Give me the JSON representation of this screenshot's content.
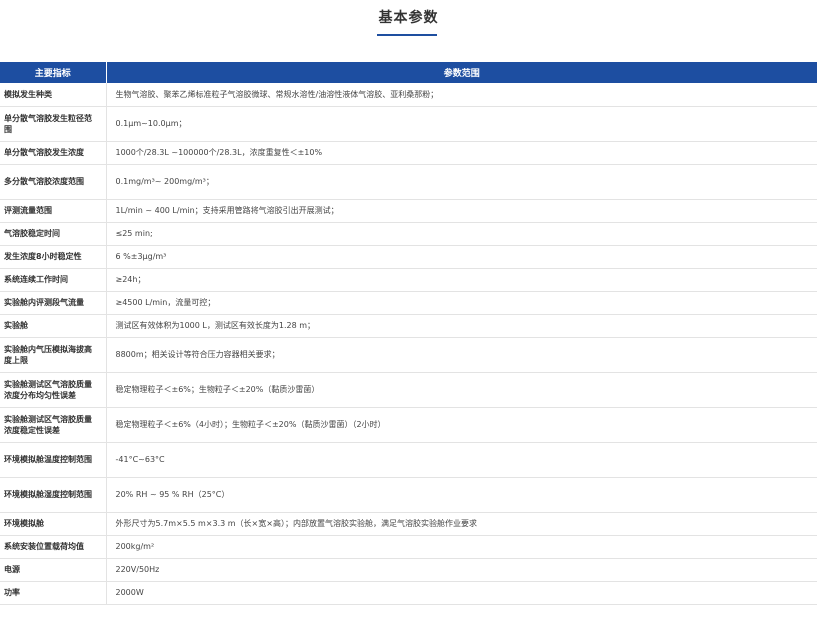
{
  "title": "基本参数",
  "table": {
    "headers": [
      "主要指标",
      "参数范围"
    ],
    "rows": [
      {
        "key": "模拟发生种类",
        "value": "生物气溶胶、聚苯乙烯标准粒子气溶胶微球、常规水溶性/油溶性液体气溶胶、亚利桑那粉；"
      },
      {
        "key": "单分散气溶胶发生粒径范围",
        "value": "0.1μm~10.0μm；"
      },
      {
        "key": "单分散气溶胶发生浓度",
        "value": "1000个/28.3L ~100000个/28.3L，浓度重复性＜±10%"
      },
      {
        "key": "多分散气溶胶浓度范围",
        "value": "0.1mg/m³~ 200mg/m³；"
      },
      {
        "key": "评测流量范围",
        "value": "1L/min ~ 400 L/min；支持采用管路将气溶胶引出开展测试；"
      },
      {
        "key": "气溶胶稳定时间",
        "value": "≤25 min;"
      },
      {
        "key": "发生浓度8小时稳定性",
        "value": "6 %±3μg/m³"
      },
      {
        "key": "系统连续工作时间",
        "value": "≥24h；"
      },
      {
        "key": "实验舱内评测段气流量",
        "value": "≥4500 L/min，流量可控；"
      },
      {
        "key": "实验舱",
        "value": "测试区有效体积为1000 L，测试区有效长度为1.28 m；"
      },
      {
        "key": "实验舱内气压模拟海拔高度上限",
        "value": "8800m；相关设计等符合压力容器相关要求；"
      },
      {
        "key": "实验舱测试区气溶胶质量浓度分布均匀性误差",
        "value": "稳定物理粒子＜±6%；生物粒子＜±20%（黏质沙雷菌）"
      },
      {
        "key": "实验舱测试区气溶胶质量浓度稳定性误差",
        "value": "稳定物理粒子＜±6%（4小时）；生物粒子＜±20%（黏质沙雷菌）（2小时）"
      },
      {
        "key": "环境模拟舱温度控制范围",
        "value": "-41°C~63°C"
      },
      {
        "key": "环境模拟舱湿度控制范围",
        "value": "20% RH ~ 95 % RH（25°C）"
      },
      {
        "key": "环境模拟舱",
        "value": "外形尺寸为5.7m×5.5 m×3.3 m（长×宽×高）；内部放置气溶胶实验舱，满足气溶胶实验舱作业要求"
      },
      {
        "key": "系统安装位置载荷均值",
        "value": "200kg/m²"
      },
      {
        "key": "电源",
        "value": "220V/50Hz"
      },
      {
        "key": "功率",
        "value": "2000W"
      }
    ]
  }
}
